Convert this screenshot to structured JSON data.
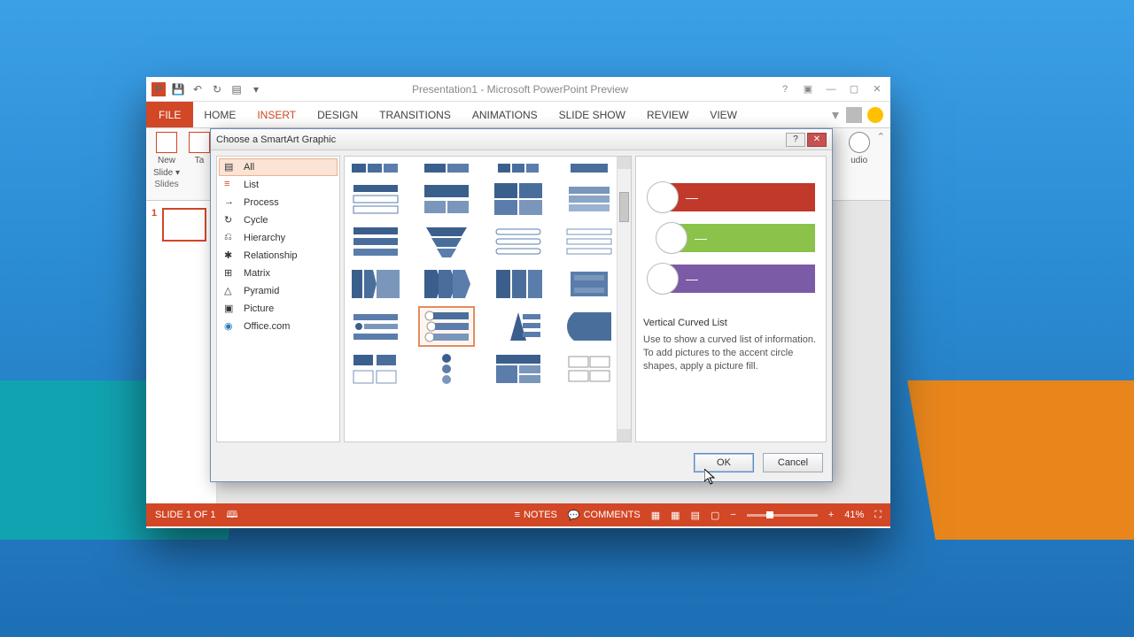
{
  "window": {
    "title": "Presentation1 - Microsoft PowerPoint Preview"
  },
  "tabs": {
    "file": "FILE",
    "items": [
      "HOME",
      "INSERT",
      "DESIGN",
      "TRANSITIONS",
      "ANIMATIONS",
      "SLIDE SHOW",
      "REVIEW",
      "VIEW"
    ],
    "active": "INSERT"
  },
  "ribbon": {
    "new_slide_top": "New",
    "new_slide_bot": "Slide ▾",
    "group_slides": "Slides",
    "tables_partial": "Ta",
    "audio_partial": "udio"
  },
  "slide_panel": {
    "slides": [
      {
        "num": "1"
      }
    ]
  },
  "statusbar": {
    "slide": "SLIDE 1 OF 1",
    "notes": "NOTES",
    "comments": "COMMENTS",
    "zoom": "41%"
  },
  "dialog": {
    "title": "Choose a SmartArt Graphic",
    "categories": [
      {
        "id": "all",
        "label": "All",
        "selected": true
      },
      {
        "id": "list",
        "label": "List"
      },
      {
        "id": "process",
        "label": "Process"
      },
      {
        "id": "cycle",
        "label": "Cycle"
      },
      {
        "id": "hierarchy",
        "label": "Hierarchy"
      },
      {
        "id": "relationship",
        "label": "Relationship"
      },
      {
        "id": "matrix",
        "label": "Matrix"
      },
      {
        "id": "pyramid",
        "label": "Pyramid"
      },
      {
        "id": "picture",
        "label": "Picture"
      },
      {
        "id": "office",
        "label": "Office.com"
      }
    ],
    "selected_layout": "vertical-curved-list",
    "preview": {
      "title": "Vertical Curved List",
      "desc": "Use to show a curved list of information. To add pictures to the accent circle shapes, apply a picture fill.",
      "colors": [
        "#c0392b",
        "#8bc34a",
        "#7b5aa6"
      ]
    },
    "buttons": {
      "ok": "OK",
      "cancel": "Cancel"
    }
  }
}
